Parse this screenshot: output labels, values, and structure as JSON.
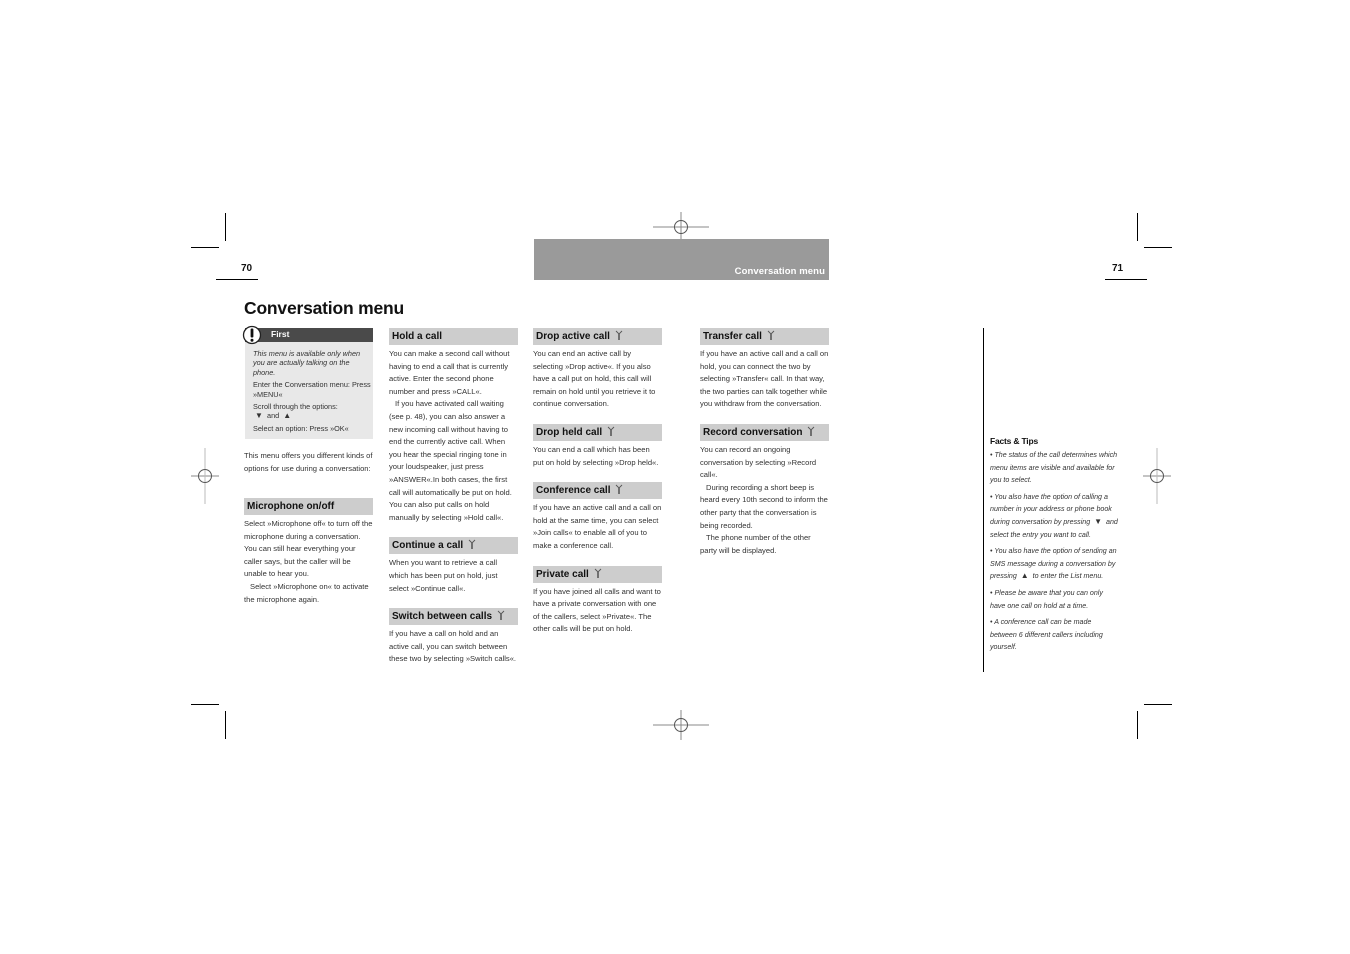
{
  "header": {
    "left_page_number": "70",
    "right_page_number": "71",
    "running_title": "Conversation menu"
  },
  "page_title": "Conversation menu",
  "first_box": {
    "label": "First",
    "icon": "exclamation-icon",
    "note": "This menu is available only when you are actually talking on the phone.",
    "step1": "Enter the Conversation menu: Press »MENU«",
    "step2_prefix": "Scroll through the options:",
    "step2_down": "▼",
    "step2_and": "and",
    "step2_up": "▲",
    "step3": "Select an option: Press »OK«"
  },
  "intro": "This menu offers you different kinds of options for use during a conversation:",
  "sections": {
    "microphone": {
      "title": "Microphone on/off",
      "p1": "Select »Microphone off« to turn off the microphone during a conversation. You can still hear everything your caller says, but the caller will be unable to hear you.",
      "p2": "Select »Microphone on« to activate the microphone again."
    },
    "hold": {
      "title": "Hold a call",
      "p1": "You can make a second call without having to end a call that is currently active. Enter the second phone number and press »CALL«.",
      "p2": "If you have activated call waiting (see p. 48), you can also answer a new incoming call without having to end the currently active call. When you hear the special ringing tone in your loudspeaker, just press »ANSWER«.In both cases, the first call will automatically be put on hold. You can also put calls on hold manually by selecting »Hold call«."
    },
    "continue": {
      "title": "Continue a call",
      "icon": "network-service-icon",
      "p1": "When you want to retrieve a call which has been put on hold, just select »Continue call«."
    },
    "switch": {
      "title": "Switch between calls",
      "icon": "network-service-icon",
      "p1": "If you have a call on hold and an active call, you can switch between these two by selecting »Switch calls«."
    },
    "drop_active": {
      "title": "Drop active call",
      "icon": "network-service-icon",
      "p1": "You can end an active call by selecting »Drop active«. If you also have a call put on hold, this call will remain on hold until you retrieve it to continue conversation."
    },
    "drop_held": {
      "title": "Drop held call",
      "icon": "network-service-icon",
      "p1": "You can end a call which has been put on hold by selecting »Drop held«."
    },
    "conference": {
      "title": "Conference call",
      "icon": "network-service-icon",
      "p1": "If you have an active call and a call on hold at the same time, you can select »Join calls« to enable all of you to make a conference call."
    },
    "private": {
      "title": "Private call",
      "icon": "network-service-icon",
      "p1": "If you have joined all calls and want to have a private conversation with one of the callers, select »Private«. The other calls will be put on hold."
    },
    "transfer": {
      "title": "Transfer call",
      "icon": "network-service-icon",
      "p1": "If you have an active call and a call on hold, you can connect the two by selecting »Transfer« call. In that way, the two parties can talk together while you withdraw from the conversation."
    },
    "record": {
      "title": "Record conversation",
      "icon": "network-service-icon",
      "p1": "You can record an ongoing conversation by selecting »Record call«.",
      "p2": "During recording a short beep is heard every 10th second to inform the other party that the conversation is being recorded.",
      "p3": "The phone number of the other party will be displayed."
    }
  },
  "facts_tips": {
    "title": "Facts & Tips",
    "tip1": "• The status of the call determines which menu items are visible and available for you to select.",
    "tip2_a": "• You also have the option of calling a number in your address or phone book during conversation by pressing",
    "tip2_key": "▼",
    "tip2_b": "and select the entry you want to call.",
    "tip3_a": "• You also have the option of sending an SMS message during a conversation by pressing",
    "tip3_key": "▲",
    "tip3_b": "to enter the List menu.",
    "tip4": "• Please be aware that you can only have one call on hold at a time.",
    "tip5": "• A conference call can be made between 6 different callers including yourself."
  }
}
